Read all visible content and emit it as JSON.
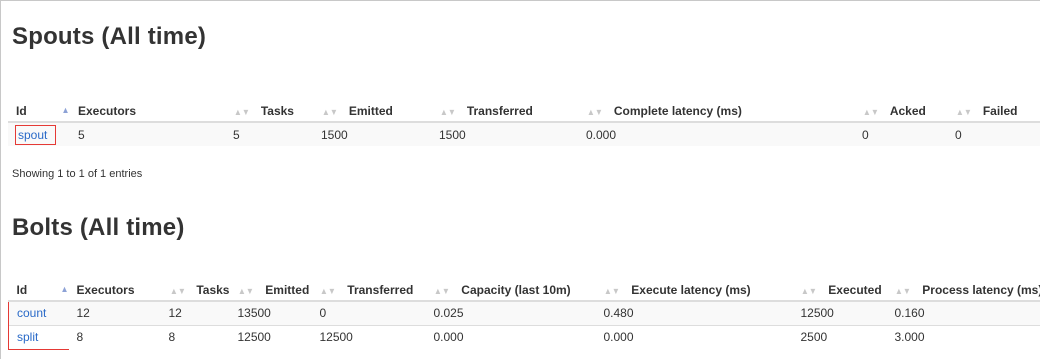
{
  "spouts": {
    "title": "Spouts (All time)",
    "headers": [
      "Id",
      "Executors",
      "Tasks",
      "Emitted",
      "Transferred",
      "Complete latency (ms)",
      "Acked",
      "Failed"
    ],
    "rows": [
      [
        "spout",
        "5",
        "5",
        "1500",
        "1500",
        "0.000",
        "0",
        "0"
      ]
    ],
    "info": "Showing 1 to 1 of 1 entries"
  },
  "bolts": {
    "title": "Bolts (All time)",
    "headers": [
      "Id",
      "Executors",
      "Tasks",
      "Emitted",
      "Transferred",
      "Capacity (last 10m)",
      "Execute latency (ms)",
      "Executed",
      "Process latency (ms)"
    ],
    "rows": [
      [
        "count",
        "12",
        "12",
        "13500",
        "0",
        "0.025",
        "0.480",
        "12500",
        "0.160"
      ],
      [
        "split",
        "8",
        "8",
        "12500",
        "12500",
        "0.000",
        "0.000",
        "2500",
        "3.000"
      ]
    ]
  },
  "colors": {
    "link": "#2a6ac8",
    "highlight": "#e53935",
    "sort_active": "#8da2d6"
  }
}
